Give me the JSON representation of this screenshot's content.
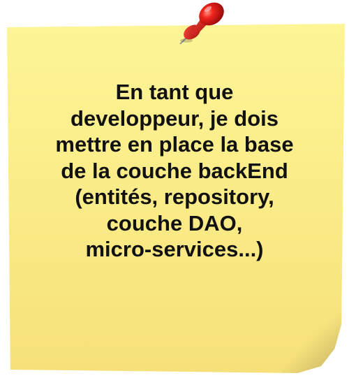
{
  "note": {
    "lines": [
      "En tant que",
      "developpeur, je dois",
      "mettre en place la base",
      "de la couche backEnd",
      "(entités, repository,",
      "couche DAO,",
      "micro-services...)"
    ]
  },
  "pin": {
    "icon": "pushpin-icon",
    "color": "#e0191b"
  },
  "colors": {
    "note": "#faeb86",
    "text": "#111111"
  }
}
